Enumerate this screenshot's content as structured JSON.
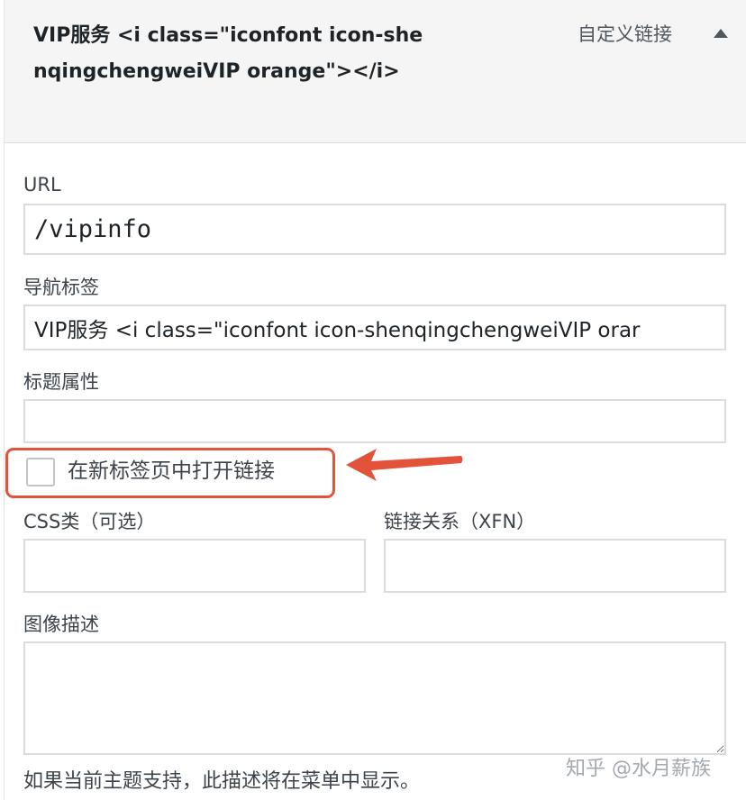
{
  "menu_item": {
    "title": "VIP服务 <i class=\"iconfont icon-shenqingchengweiVIP orange\"></i>",
    "type_label": "自定义链接",
    "toggle_icon": "triangle-up-icon"
  },
  "fields": {
    "url": {
      "label": "URL",
      "value": "/vipinfo"
    },
    "nav_label": {
      "label": "导航标签",
      "value": "VIP服务 <i class=\"iconfont icon-shenqingchengweiVIP orar"
    },
    "title_attr": {
      "label": "标题属性",
      "value": ""
    },
    "new_tab": {
      "label": "在新标签页中打开链接",
      "checked": false
    },
    "css_classes": {
      "label": "CSS类（可选）",
      "value": ""
    },
    "xfn": {
      "label": "链接关系（XFN）",
      "value": ""
    },
    "description": {
      "label": "图像描述",
      "value": "",
      "hint": "如果当前主题支持，此描述将在菜单中显示。"
    }
  },
  "annotation": {
    "arrow_color": "#e2533a",
    "highlight_color": "#e2533a"
  },
  "watermark": "知乎 @水月薪族"
}
